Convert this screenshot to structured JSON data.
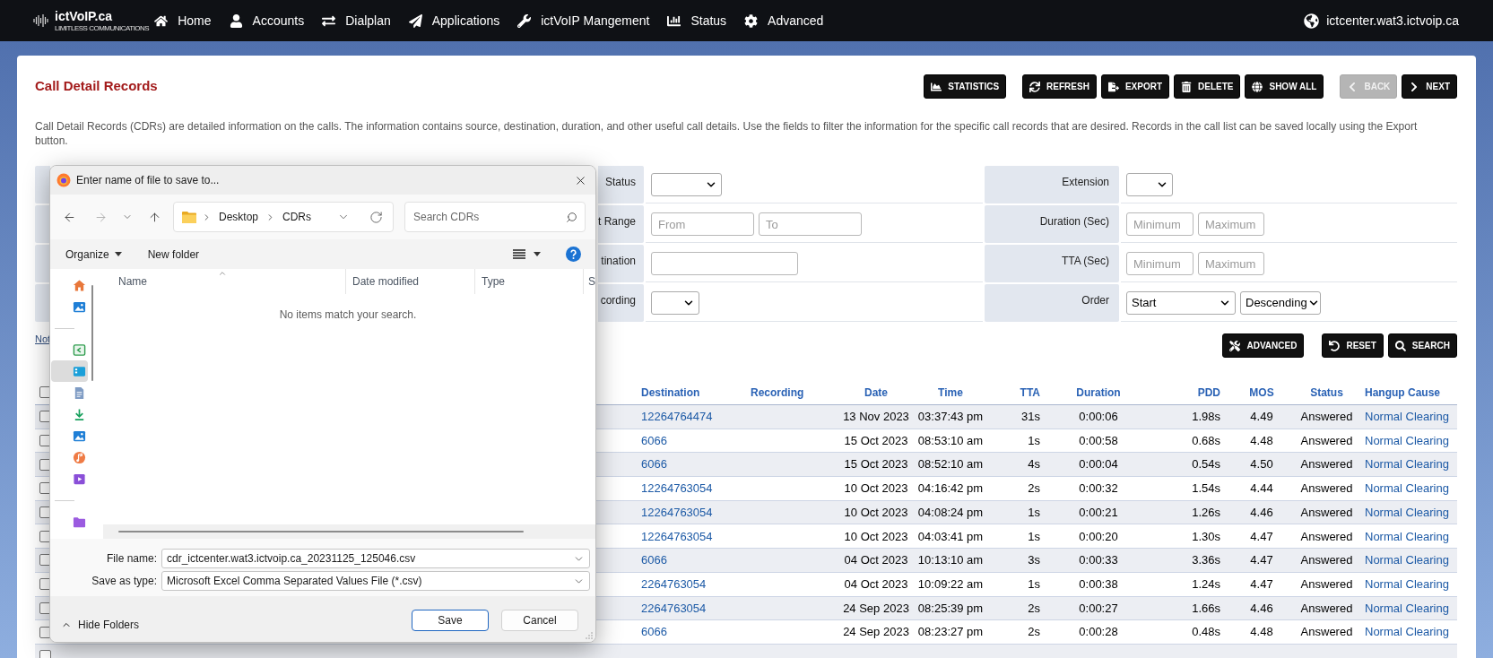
{
  "navbar": {
    "logo": {
      "name": "ictVoIP.ca",
      "tagline": "LIMITLESS COMMUNICATIONS"
    },
    "items": [
      {
        "label": "Home"
      },
      {
        "label": "Accounts"
      },
      {
        "label": "Dialplan"
      },
      {
        "label": "Applications"
      },
      {
        "label": "ictVoIP Mangement"
      },
      {
        "label": "Status"
      },
      {
        "label": "Advanced"
      }
    ],
    "host": "ictcenter.wat3.ictvoip.ca"
  },
  "header": {
    "title": "Call Detail Records",
    "toolbar": [
      {
        "buttons": [
          {
            "label": "STATISTICS",
            "disabled": false
          }
        ]
      },
      {
        "buttons": [
          {
            "label": "REFRESH",
            "disabled": false
          },
          {
            "label": "EXPORT",
            "disabled": false
          },
          {
            "label": "DELETE",
            "disabled": false
          },
          {
            "label": "SHOW ALL",
            "disabled": false
          }
        ]
      },
      {
        "buttons": [
          {
            "label": "BACK",
            "disabled": true
          },
          {
            "label": "NEXT",
            "disabled": false
          }
        ]
      }
    ],
    "description": "Call Detail Records (CDRs) are detailed information on the calls. The information contains source, destination, duration, and other useful call details. Use the fields to filter the information for the specific call records that are desired. Records in the call list can be saved locally using the Export button."
  },
  "filters": {
    "rows": [
      {
        "left": {
          "label": "Status",
          "fields": [
            {
              "kind": "select"
            }
          ]
        },
        "right": {
          "label": "Extension",
          "fields": [
            {
              "kind": "select"
            }
          ]
        }
      },
      {
        "left": {
          "label": "t Range",
          "fields": [
            {
              "kind": "text",
              "placeholder": "From"
            },
            {
              "kind": "text",
              "placeholder": "To"
            }
          ]
        },
        "right": {
          "label": "Duration (Sec)",
          "fields": [
            {
              "kind": "text",
              "placeholder": "Minimum"
            },
            {
              "kind": "text",
              "placeholder": "Maximum"
            }
          ]
        }
      },
      {
        "left": {
          "label": "tination",
          "fields": [
            {
              "kind": "text"
            }
          ]
        },
        "right": {
          "label": "TTA (Sec)",
          "fields": [
            {
              "kind": "text",
              "placeholder": "Minimum"
            },
            {
              "kind": "text",
              "placeholder": "Maximum"
            }
          ]
        }
      },
      {
        "left": {
          "label": "cording",
          "fields": [
            {
              "kind": "select"
            }
          ]
        },
        "right": {
          "label": "Order",
          "fields": [
            {
              "kind": "select",
              "value": "Start"
            },
            {
              "kind": "select",
              "value": "Descending"
            }
          ]
        }
      }
    ]
  },
  "note_link": "Not",
  "actions": [
    {
      "buttons": [
        {
          "label": "ADVANCED"
        }
      ]
    },
    {
      "buttons": [
        {
          "label": "RESET"
        },
        {
          "label": "SEARCH"
        }
      ]
    }
  ],
  "table": {
    "select_all": {
      "checked": false
    },
    "columns": [
      {
        "label": "Destination",
        "kind": "link"
      },
      {
        "label": "Recording",
        "kind": "text"
      },
      {
        "label": "Date",
        "kind": "text"
      },
      {
        "label": "Time",
        "kind": "text"
      },
      {
        "label": "TTA",
        "kind": "text"
      },
      {
        "label": "Duration",
        "kind": "text"
      },
      {
        "label": "PDD",
        "kind": "text"
      },
      {
        "label": "MOS",
        "kind": "text"
      },
      {
        "label": "Status",
        "kind": "text"
      },
      {
        "label": "Hangup Cause",
        "kind": "link"
      }
    ],
    "rows": [
      {
        "checked": false,
        "destination": "12264764474",
        "date": "13 Nov 2023",
        "time": "03:37:43 pm",
        "tta": "31s",
        "duration": "0:00:06",
        "pdd": "1.98s",
        "mos": "4.49",
        "status": "Answered",
        "hangup_cause": "Normal Clearing"
      },
      {
        "checked": false,
        "destination": "6066",
        "date": "15 Oct 2023",
        "time": "08:53:10 am",
        "tta": "1s",
        "duration": "0:00:58",
        "pdd": "0.68s",
        "mos": "4.48",
        "status": "Answered",
        "hangup_cause": "Normal Clearing"
      },
      {
        "checked": false,
        "destination": "6066",
        "date": "15 Oct 2023",
        "time": "08:52:10 am",
        "tta": "4s",
        "duration": "0:00:04",
        "pdd": "0.54s",
        "mos": "4.50",
        "status": "Answered",
        "hangup_cause": "Normal Clearing"
      },
      {
        "checked": false,
        "destination": "12264763054",
        "date": "10 Oct 2023",
        "time": "04:16:42 pm",
        "tta": "2s",
        "duration": "0:00:32",
        "pdd": "1.54s",
        "mos": "4.44",
        "status": "Answered",
        "hangup_cause": "Normal Clearing"
      },
      {
        "checked": false,
        "destination": "12264763054",
        "date": "10 Oct 2023",
        "time": "04:08:24 pm",
        "tta": "1s",
        "duration": "0:00:21",
        "pdd": "1.26s",
        "mos": "4.46",
        "status": "Answered",
        "hangup_cause": "Normal Clearing"
      },
      {
        "checked": false,
        "destination": "12264763054",
        "date": "10 Oct 2023",
        "time": "04:03:41 pm",
        "tta": "1s",
        "duration": "0:00:20",
        "pdd": "1.30s",
        "mos": "4.47",
        "status": "Answered",
        "hangup_cause": "Normal Clearing"
      },
      {
        "checked": false,
        "destination": "6066",
        "date": "04 Oct 2023",
        "time": "10:13:10 am",
        "tta": "3s",
        "duration": "0:00:33",
        "pdd": "3.36s",
        "mos": "4.47",
        "status": "Answered",
        "hangup_cause": "Normal Clearing"
      },
      {
        "checked": false,
        "destination": "2264763054",
        "date": "04 Oct 2023",
        "time": "10:09:22 am",
        "tta": "1s",
        "duration": "0:00:38",
        "pdd": "1.24s",
        "mos": "4.47",
        "status": "Answered",
        "hangup_cause": "Normal Clearing"
      },
      {
        "checked": false,
        "destination": "2264763054",
        "date": "24 Sep 2023",
        "time": "08:25:39 pm",
        "tta": "2s",
        "duration": "0:00:27",
        "pdd": "1.66s",
        "mos": "4.46",
        "status": "Answered",
        "hangup_cause": "Normal Clearing"
      },
      {
        "checked": false,
        "destination": "6066",
        "date": "24 Sep 2023",
        "time": "08:23:27 pm",
        "tta": "2s",
        "duration": "0:00:28",
        "pdd": "0.48s",
        "mos": "4.48",
        "status": "Answered",
        "hangup_cause": "Normal Clearing"
      },
      {
        "checked": false
      }
    ]
  },
  "dialog": {
    "title": "Enter name of file to save to...",
    "path": [
      {
        "label": "Desktop"
      },
      {
        "label": "CDRs"
      }
    ],
    "search": {
      "placeholder": "Search CDRs"
    },
    "toolbar": [
      {
        "label": "Organize",
        "menu": true
      },
      {
        "label": "New folder",
        "menu": false
      }
    ],
    "nav_pane": [
      {
        "kind": "item",
        "selected": false
      },
      {
        "kind": "item",
        "selected": false
      },
      {
        "kind": "separator"
      },
      {
        "kind": "item",
        "selected": false
      },
      {
        "kind": "item",
        "selected": true
      },
      {
        "kind": "item",
        "selected": false
      },
      {
        "kind": "item",
        "selected": false
      },
      {
        "kind": "item",
        "selected": false
      },
      {
        "kind": "item",
        "selected": false
      },
      {
        "kind": "item",
        "selected": false
      },
      {
        "kind": "separator"
      },
      {
        "kind": "item",
        "selected": false
      }
    ],
    "columns": [
      {
        "label": "Name",
        "sorted": true
      },
      {
        "label": "Date modified",
        "sorted": false
      },
      {
        "label": "Type",
        "sorted": false
      },
      {
        "label": "S",
        "sorted": false
      }
    ],
    "empty_message": "No items match your search.",
    "fields": [
      {
        "label": "File name:",
        "value": "cdr_ictcenter.wat3.ictvoip.ca_20231125_125046.csv"
      },
      {
        "label": "Save as type:",
        "value": "Microsoft Excel Comma Separated Values File (*.csv)"
      }
    ],
    "hide_folders": "Hide Folders",
    "buttons": [
      {
        "label": "Save",
        "default": true
      },
      {
        "label": "Cancel",
        "default": false
      }
    ]
  }
}
